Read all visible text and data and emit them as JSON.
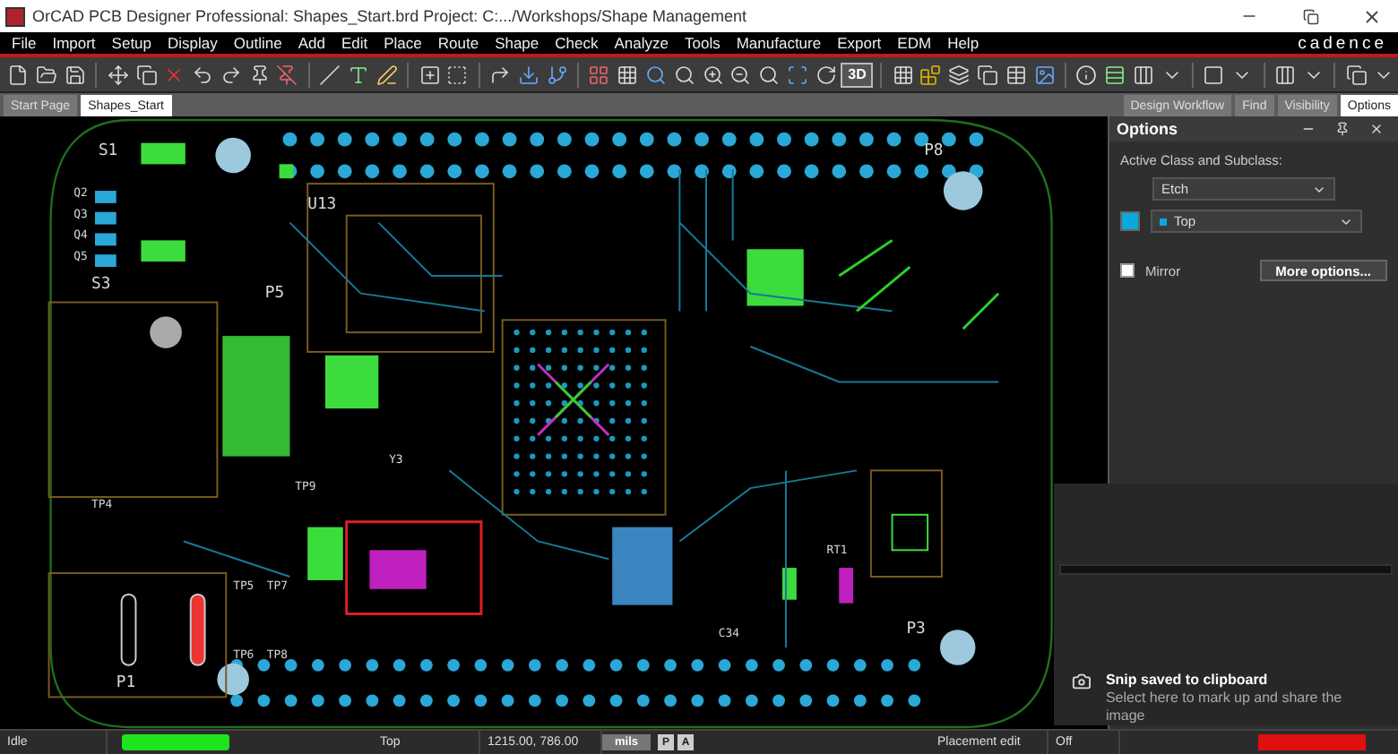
{
  "window": {
    "title": "OrCAD PCB Designer Professional: Shapes_Start.brd  Project: C:.../Workshops/Shape Management"
  },
  "menu": [
    "File",
    "Import",
    "Setup",
    "Display",
    "Outline",
    "Add",
    "Edit",
    "Place",
    "Route",
    "Shape",
    "Check",
    "Analyze",
    "Tools",
    "Manufacture",
    "Export",
    "EDM",
    "Help"
  ],
  "logo": "cadence",
  "toolbar": {
    "view_3d_label": "3D"
  },
  "document_tabs": [
    {
      "label": "Start Page",
      "selected": false
    },
    {
      "label": "Shapes_Start",
      "selected": true
    }
  ],
  "panel_tabs": [
    {
      "label": "Design Workflow",
      "selected": false
    },
    {
      "label": "Find",
      "selected": false
    },
    {
      "label": "Visibility",
      "selected": false
    },
    {
      "label": "Options",
      "selected": true
    }
  ],
  "options_panel": {
    "title": "Options",
    "class_label": "Active Class and Subclass:",
    "class_value": "Etch",
    "subclass_value": "Top",
    "mirror_label": "Mirror",
    "mirror_checked": false,
    "more_button": "More options..."
  },
  "silkscreen": [
    "S1",
    "S3",
    "Q2",
    "Q3",
    "Q4",
    "Q5",
    "P5",
    "U13",
    "P8",
    "Y3",
    "TP9",
    "TP4",
    "TP5",
    "TP7",
    "TP6",
    "TP8",
    "C34",
    "RT1",
    "P3",
    "P1"
  ],
  "status_bar": {
    "state": "Idle",
    "layer": "Top",
    "coordinates": "1215.00, 786.00",
    "units": "mils",
    "p_button": "P",
    "a_button": "A",
    "mode": "Placement edit",
    "snap": "Off"
  },
  "notification": {
    "title": "Snip saved to clipboard",
    "message": "Select here to mark up and share the image"
  }
}
